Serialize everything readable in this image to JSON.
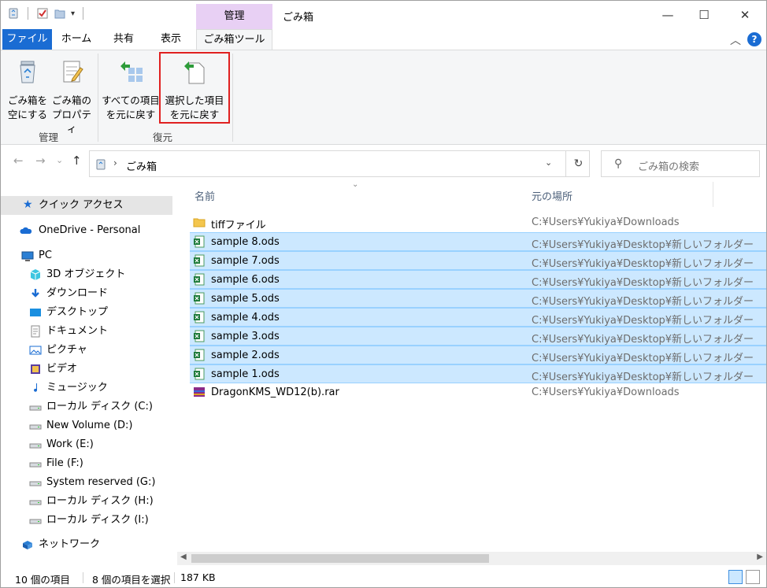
{
  "window": {
    "title": "ごみ箱",
    "context_tab_header": "管理",
    "controls": {
      "minimize": "—",
      "maximize": "☐",
      "close": "✕"
    }
  },
  "ribbon_tabs": {
    "file": "ファイル",
    "home": "ホーム",
    "share": "共有",
    "view": "表示",
    "recycle_tools": "ごみ箱ツール",
    "collapse": "︿",
    "help": "?"
  },
  "ribbon": {
    "empty_line1": "ごみ箱を",
    "empty_line2": "空にする",
    "props_line1": "ごみ箱の",
    "props_line2": "プロパティ",
    "group_manage": "管理",
    "restore_all_line1": "すべての項目",
    "restore_all_line2": "を元に戻す",
    "restore_sel_line1": "選択した項目",
    "restore_sel_line2": "を元に戻す",
    "group_restore": "復元"
  },
  "address": {
    "back": "←",
    "forward": "→",
    "recent": "⌄",
    "up": "↑",
    "breadcrumb": "ごみ箱",
    "dropdown": "⌄",
    "refresh": "↻",
    "search_placeholder": "ごみ箱の検索"
  },
  "nav": {
    "quick_access": "クイック アクセス",
    "onedrive": "OneDrive - Personal",
    "pc": "PC",
    "items": [
      "3D オブジェクト",
      "ダウンロード",
      "デスクトップ",
      "ドキュメント",
      "ピクチャ",
      "ビデオ",
      "ミュージック",
      "ローカル ディスク (C:)",
      "New Volume (D:)",
      "Work (E:)",
      "File (F:)",
      "System reserved (G:)",
      "ローカル ディスク (H:)",
      "ローカル ディスク (I:)"
    ],
    "network": "ネットワーク"
  },
  "columns": {
    "name": "名前",
    "original_location": "元の場所"
  },
  "files": [
    {
      "name": "tiffファイル",
      "path": "C:¥Users¥Yukiya¥Downloads",
      "selected": false,
      "icon": "folder-icon"
    },
    {
      "name": "sample 8.ods",
      "path": "C:¥Users¥Yukiya¥Desktop¥新しいフォルダー",
      "selected": true,
      "icon": "spreadsheet-icon"
    },
    {
      "name": "sample 7.ods",
      "path": "C:¥Users¥Yukiya¥Desktop¥新しいフォルダー",
      "selected": true,
      "icon": "spreadsheet-icon"
    },
    {
      "name": "sample 6.ods",
      "path": "C:¥Users¥Yukiya¥Desktop¥新しいフォルダー",
      "selected": true,
      "icon": "spreadsheet-icon"
    },
    {
      "name": "sample 5.ods",
      "path": "C:¥Users¥Yukiya¥Desktop¥新しいフォルダー",
      "selected": true,
      "icon": "spreadsheet-icon"
    },
    {
      "name": "sample 4.ods",
      "path": "C:¥Users¥Yukiya¥Desktop¥新しいフォルダー",
      "selected": true,
      "icon": "spreadsheet-icon"
    },
    {
      "name": "sample 3.ods",
      "path": "C:¥Users¥Yukiya¥Desktop¥新しいフォルダー",
      "selected": true,
      "icon": "spreadsheet-icon"
    },
    {
      "name": "sample 2.ods",
      "path": "C:¥Users¥Yukiya¥Desktop¥新しいフォルダー",
      "selected": true,
      "icon": "spreadsheet-icon"
    },
    {
      "name": "sample 1.ods",
      "path": "C:¥Users¥Yukiya¥Desktop¥新しいフォルダー",
      "selected": true,
      "icon": "spreadsheet-icon"
    },
    {
      "name": "DragonKMS_WD12(b).rar",
      "path": "C:¥Users¥Yukiya¥Downloads",
      "selected": false,
      "icon": "archive-icon"
    }
  ],
  "status": {
    "item_count": "10 個の項目",
    "selected_count": "8 個の項目を選択",
    "size": "187 KB"
  },
  "colors": {
    "accent": "#1a6cd3",
    "context_tab": "#e8d0f4",
    "selection": "#cce8ff",
    "highlight_box": "#e02020"
  }
}
